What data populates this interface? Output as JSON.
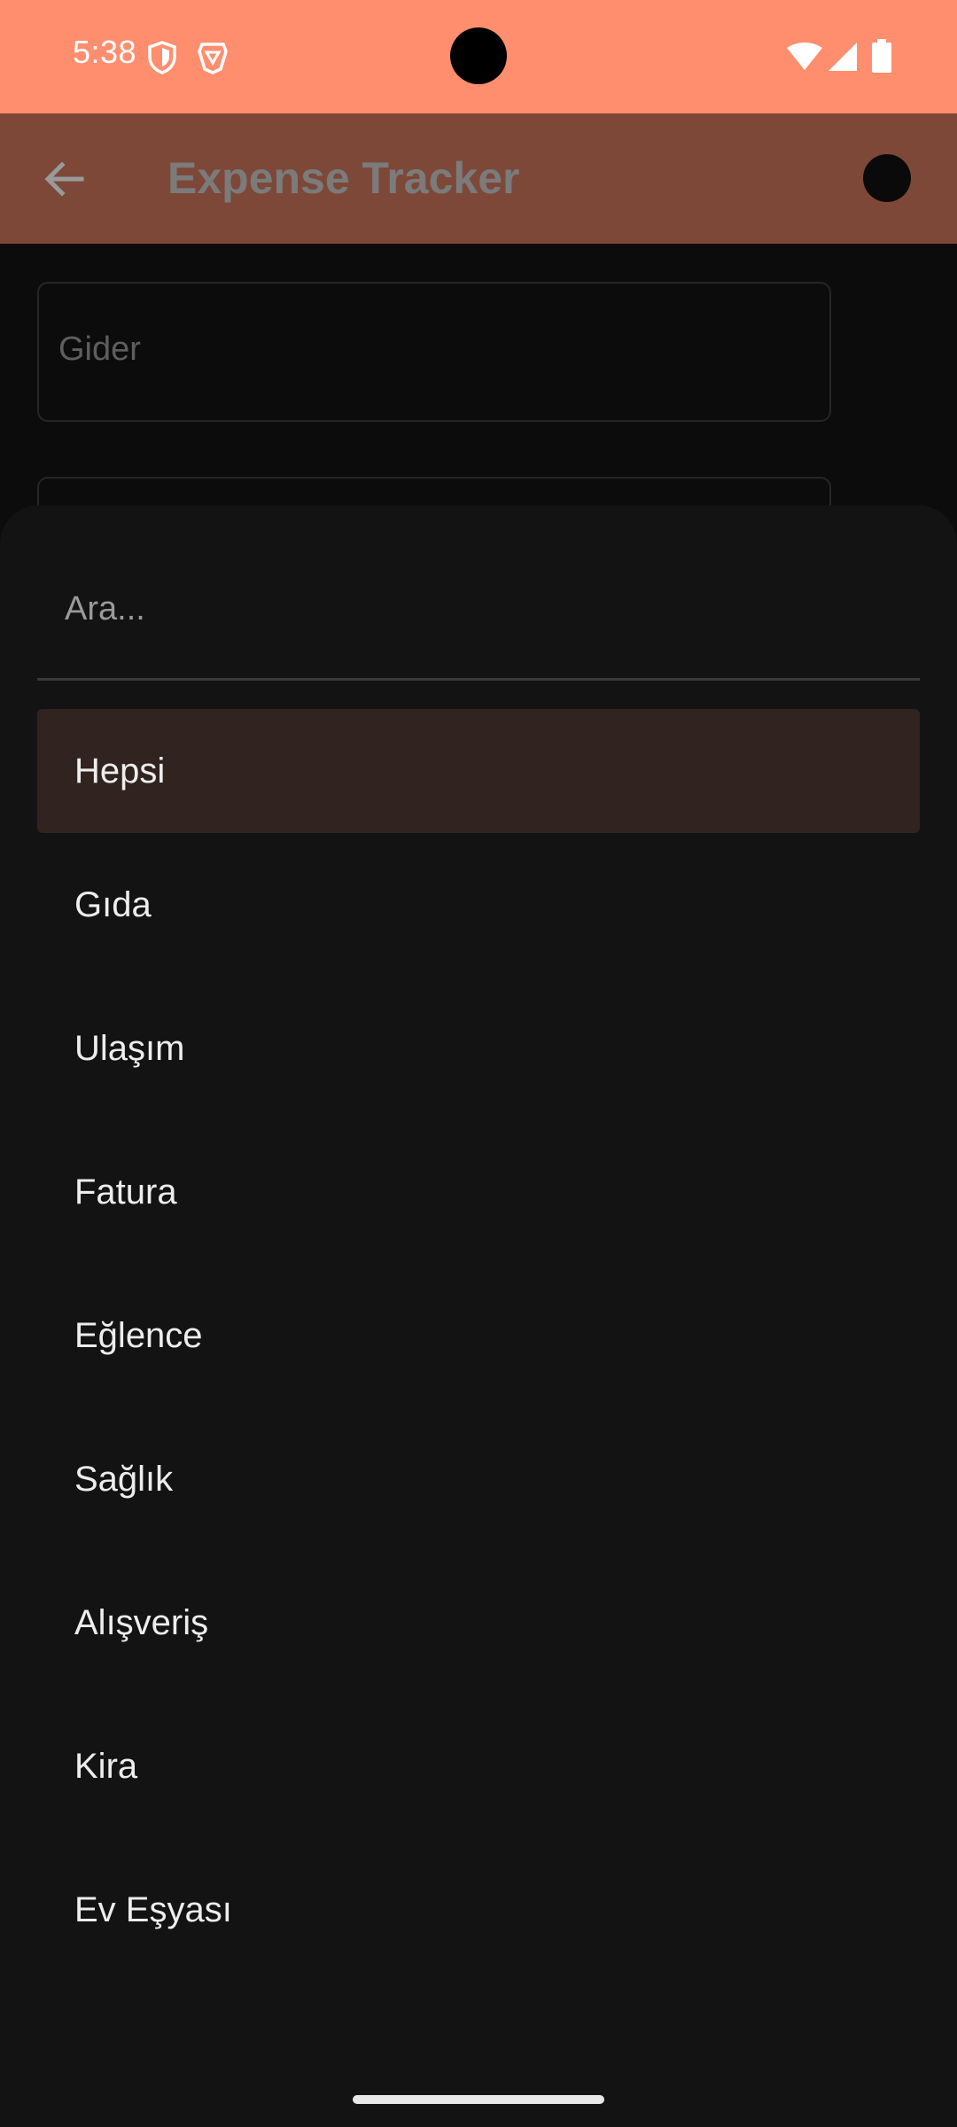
{
  "status_bar": {
    "time": "5:38",
    "color": "#FF8E6E",
    "icons_left": [
      "shield-icon",
      "brave-icon"
    ],
    "icons_right": [
      "wifi-icon",
      "signal-icon",
      "battery-icon"
    ]
  },
  "app_bar": {
    "title": "Expense Tracker",
    "back_icon": "arrow-back-icon",
    "color": "#7D4838"
  },
  "form": {
    "expense_label": "Gider"
  },
  "sheet": {
    "search_placeholder": "Ara...",
    "items": [
      {
        "label": "Hepsi",
        "selected": true
      },
      {
        "label": "Gıda"
      },
      {
        "label": "Ulaşım"
      },
      {
        "label": "Fatura"
      },
      {
        "label": "Eğlence"
      },
      {
        "label": "Sağlık"
      },
      {
        "label": "Alışveriş"
      },
      {
        "label": "Kira"
      },
      {
        "label": "Ev Eşyası"
      }
    ]
  }
}
